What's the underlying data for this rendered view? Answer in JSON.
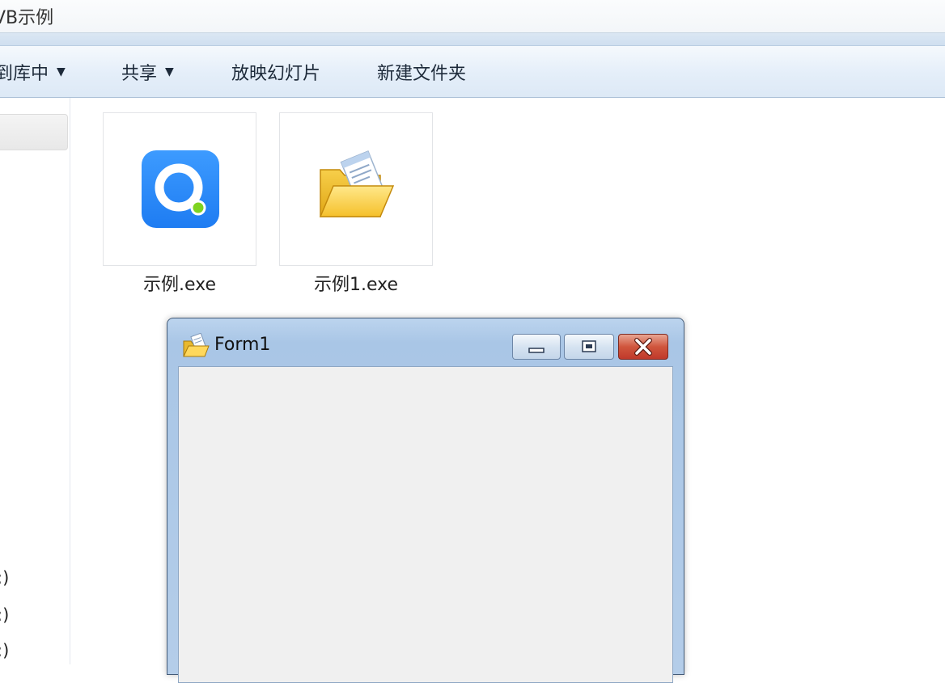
{
  "window": {
    "title": "VB示例"
  },
  "toolbar": {
    "items": [
      {
        "label": "到库中",
        "has_dropdown": true
      },
      {
        "label": "共享",
        "has_dropdown": true
      },
      {
        "label": "放映幻灯片",
        "has_dropdown": false
      },
      {
        "label": "新建文件夹",
        "has_dropdown": false
      }
    ],
    "dropdown_glyph": "▼"
  },
  "nav": {
    "drives": [
      ":)",
      ":)",
      ":)"
    ]
  },
  "files": [
    {
      "name": "示例.exe",
      "icon": "q-app-icon"
    },
    {
      "name": "示例1.exe",
      "icon": "folder-icon"
    }
  ],
  "form": {
    "title": "Form1",
    "buttons": {
      "minimize": "minimize-icon",
      "maximize": "maximize-icon",
      "close": "close-icon"
    }
  },
  "colors": {
    "q_icon": "#1e7cf2",
    "q_dot": "#7ed321",
    "close_button": "#c0392b",
    "form_client": "#f0f0f0"
  }
}
